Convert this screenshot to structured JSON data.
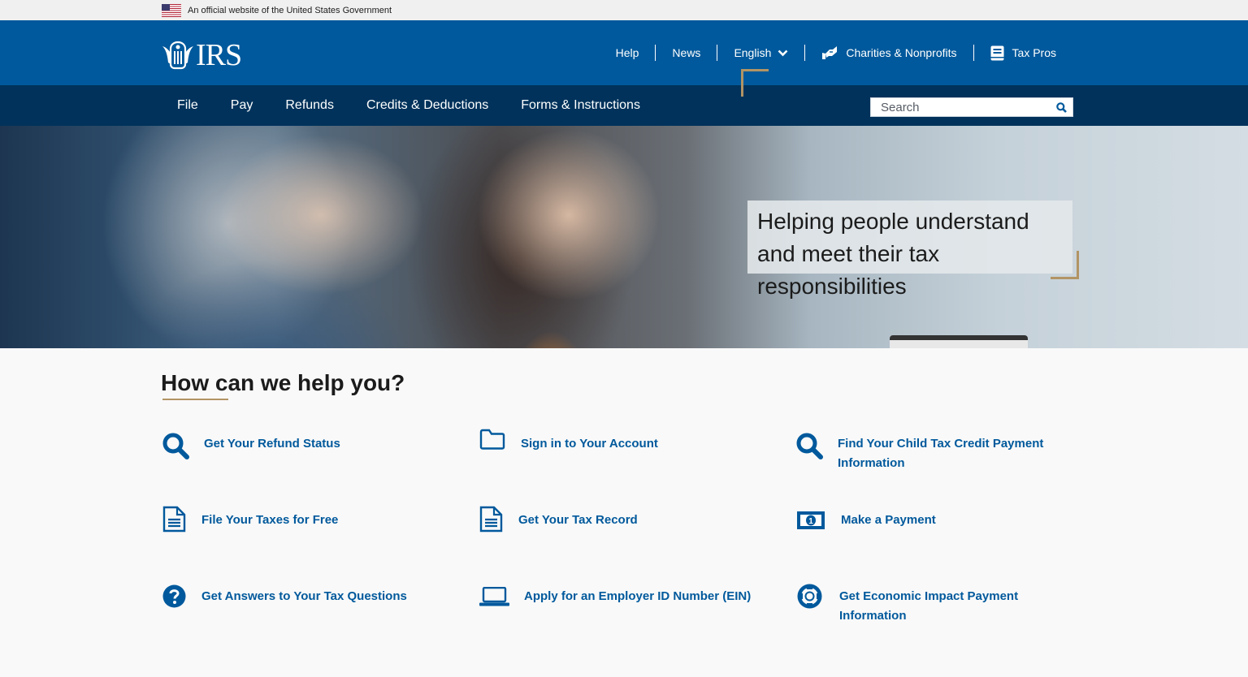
{
  "gov_banner": {
    "text": "An official website of the United States Government"
  },
  "header": {
    "logo_text": "IRS",
    "util_nav": [
      {
        "label": "Help"
      },
      {
        "label": "News"
      },
      {
        "label": "English",
        "icon": "chevron-down-icon"
      },
      {
        "label": "Charities & Nonprofits",
        "icon": "handshake-icon"
      },
      {
        "label": "Tax Pros",
        "icon": "book-icon"
      }
    ]
  },
  "main_nav": {
    "items": [
      {
        "label": "File"
      },
      {
        "label": "Pay"
      },
      {
        "label": "Refunds"
      },
      {
        "label": "Credits & Deductions"
      },
      {
        "label": "Forms & Instructions"
      }
    ],
    "search": {
      "placeholder": "Search",
      "value": ""
    }
  },
  "hero": {
    "tagline": "Helping people understand and meet their tax responsibilities"
  },
  "help": {
    "title": "How can we help you?",
    "links": [
      {
        "label": "Get Your Refund Status",
        "icon": "search-icon"
      },
      {
        "label": "Sign in to Your Account",
        "icon": "folder-icon"
      },
      {
        "label": "Find Your Child Tax Credit Payment Information",
        "icon": "search-icon"
      },
      {
        "label": "File Your Taxes for Free",
        "icon": "document-icon"
      },
      {
        "label": "Get Your Tax Record",
        "icon": "document-icon"
      },
      {
        "label": "Make a Payment",
        "icon": "money-bill-icon"
      },
      {
        "label": "Get Answers to Your Tax Questions",
        "icon": "question-circle-icon"
      },
      {
        "label": "Apply for an Employer ID Number (EIN)",
        "icon": "laptop-icon"
      },
      {
        "label": "Get Economic Impact Payment Information",
        "icon": "life-ring-icon"
      }
    ]
  },
  "colors": {
    "header_blue": "#00599c",
    "nav_navy": "#00325b",
    "accent_gold": "#b29464",
    "link_blue": "#00599c"
  }
}
